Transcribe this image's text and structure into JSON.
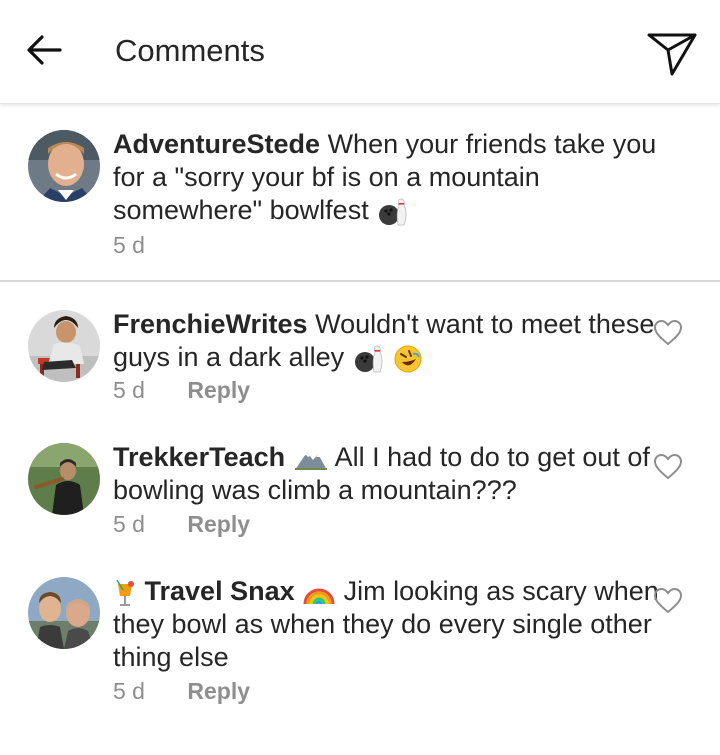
{
  "header": {
    "title": "Comments",
    "back_icon": "arrow-left-icon",
    "send_icon": "paper-plane-icon"
  },
  "caption": {
    "username": "AdventureStede",
    "text": "When your friends take you for a \"sorry your bf is on a mountain somewhere\" bowlfest",
    "emoji": "bowling-icon",
    "time": "5 d"
  },
  "comments": [
    {
      "username": "FrenchieWrites",
      "text": "Wouldn't want to meet these guys in a dark alley",
      "emojis": [
        "bowling-icon",
        "rofl-emoji"
      ],
      "time": "5 d",
      "reply_label": "Reply"
    },
    {
      "username": "TrekkerTeach",
      "username_emoji": "mountain-icon",
      "text": "All I had to do to get out of bowling was climb a mountain???",
      "time": "5 d",
      "reply_label": "Reply"
    },
    {
      "username": "Travel Snax",
      "prefix_emoji": "cocktail-icon",
      "username_emoji": "rainbow-icon",
      "text": "Jim looking as scary when they bowl as when they do every single other thing else",
      "time": "5 d",
      "reply_label": "Reply"
    }
  ],
  "colors": {
    "text": "#262626",
    "muted": "#8e8e8e",
    "divider": "#d8d8d8"
  }
}
